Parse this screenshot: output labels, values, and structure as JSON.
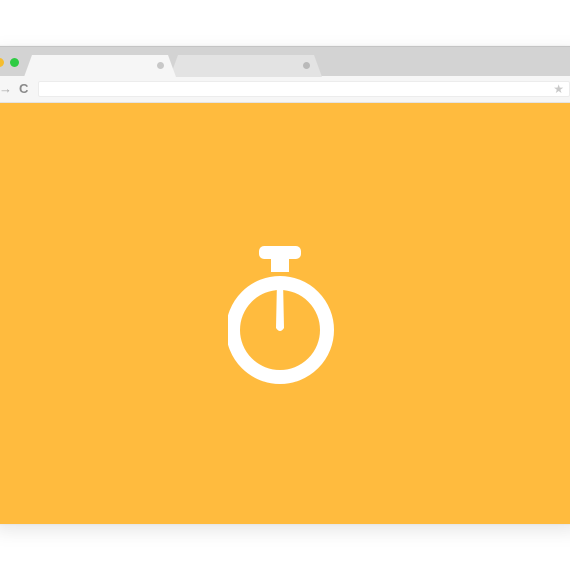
{
  "browser": {
    "window_controls": [
      "minimize-button",
      "zoom-button"
    ],
    "tabs": [
      {
        "label": "",
        "active": true
      },
      {
        "label": "",
        "active": false
      }
    ],
    "toolbar": {
      "forward_glyph": "→",
      "reload_glyph": "C",
      "address_value": "",
      "bookmark_glyph": "★"
    }
  },
  "content": {
    "background_color": "#ffbb3e",
    "icon": "stopwatch-icon",
    "icon_color": "#ffffff"
  }
}
